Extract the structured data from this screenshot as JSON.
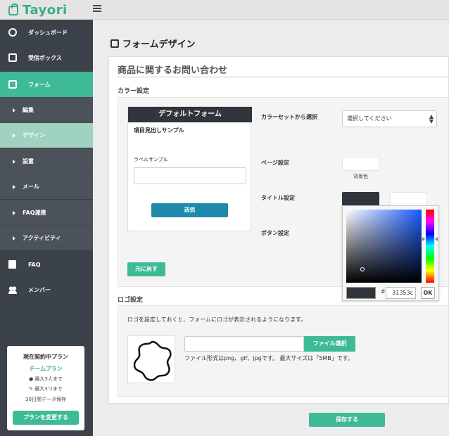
{
  "app": {
    "name": "Tayori"
  },
  "sidebar": {
    "items": [
      {
        "label": "ダッシュボード",
        "icon": "dashboard-icon"
      },
      {
        "label": "受信ボックス",
        "icon": "inbox-icon"
      },
      {
        "label": "フォーム",
        "icon": "form-icon"
      },
      {
        "label": "編集"
      },
      {
        "label": "デザイン"
      },
      {
        "label": "設置"
      },
      {
        "label": "メール"
      },
      {
        "label": "FAQ連携"
      },
      {
        "label": "アクティビティ"
      },
      {
        "label": "FAQ",
        "icon": "book-icon"
      },
      {
        "label": "メンバー",
        "icon": "users-icon"
      }
    ],
    "plan": {
      "title": "現在契約中プラン",
      "name": "チームプラン",
      "members": "最大3人まで",
      "forms": "最大3つまで",
      "retention": "30日間データ保存",
      "change_button": "プランを変更する"
    }
  },
  "page": {
    "title": "フォームデザイン",
    "form_name": "商品に関するお問い合わせ"
  },
  "color_settings": {
    "section_label": "カラー設定",
    "preview": {
      "header": "デフォルトフォーム",
      "subheading": "項目見出しサンプル",
      "label": "ラベルサンプル",
      "submit": "送信"
    },
    "reset_button": "元に戻す",
    "colorset_label": "カラーセットから選択",
    "colorset_placeholder": "選択してください",
    "page_label": "ページ設定",
    "background_caption": "背景色",
    "title_label": "タイトル設定",
    "button_label": "ボタン設定",
    "title_color": "#31353c",
    "picker": {
      "hash": "#",
      "hex": "31353c",
      "ok": "OK"
    }
  },
  "logo_settings": {
    "section_label": "ロゴ設定",
    "description": "ロゴを設定しておくと、フォームにロゴが表示されるようになります。",
    "file_button": "ファイル選択",
    "file_note": "ファイル形式はpng、gif、jpgです。 最大サイズは「5MB」です。"
  },
  "save_button": "保存する",
  "colors": {
    "accent": "#3fba96",
    "sidebar": "#3b4249",
    "submit": "#1e8aab"
  }
}
